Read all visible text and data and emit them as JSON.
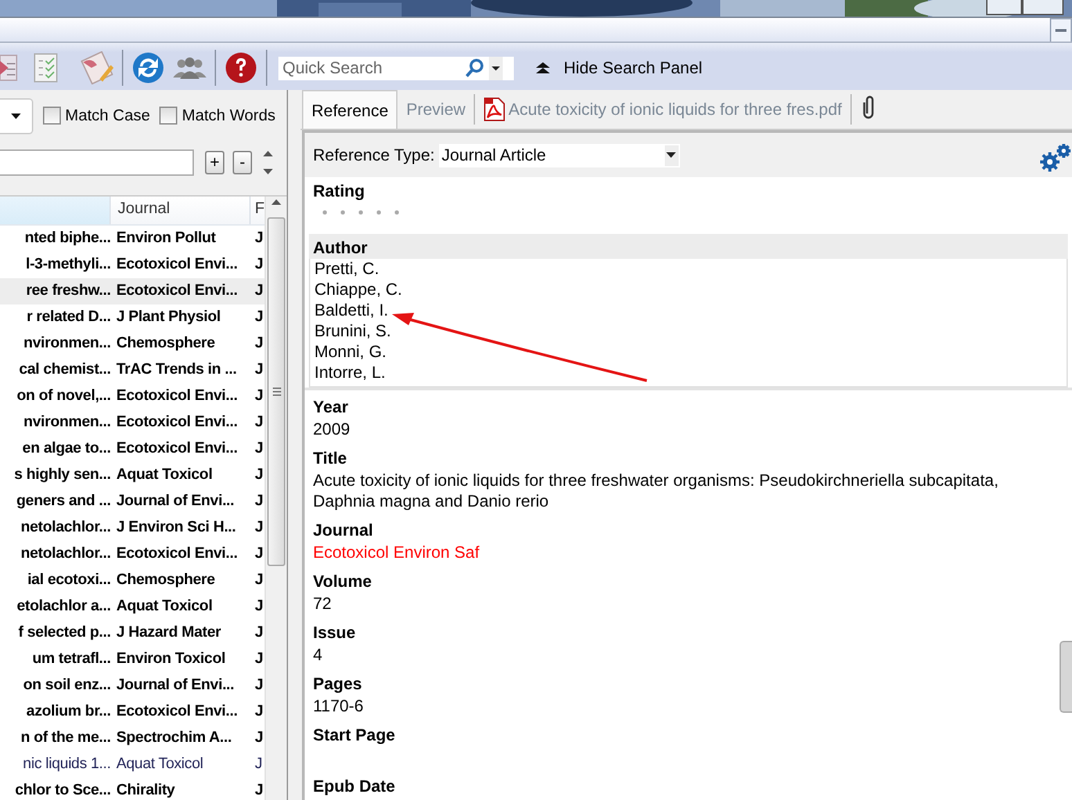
{
  "toolbar": {
    "search": {
      "placeholder": "Quick Search"
    },
    "hide_panel_button": "Hide Search Panel"
  },
  "search_options": {
    "checkboxes": [
      {
        "label": "Match Case",
        "checked": false
      },
      {
        "label": "Match Words",
        "checked": false
      }
    ],
    "add_button": "+",
    "remove_button": "-"
  },
  "reference_list": {
    "columns": [
      {
        "label": "Journal"
      },
      {
        "label": "F"
      }
    ],
    "rows": [
      {
        "title": "nted biphe...",
        "journal": "Environ Pollut",
        "column_3": "J",
        "unread": true,
        "selected": false
      },
      {
        "title": "l-3-methyli...",
        "journal": "Ecotoxicol Envi...",
        "column_3": "J",
        "unread": true,
        "selected": false
      },
      {
        "title": "ree freshw...",
        "journal": "Ecotoxicol Envi...",
        "column_3": "J",
        "unread": true,
        "selected": true
      },
      {
        "title": "r related D...",
        "journal": "J Plant Physiol",
        "column_3": "J",
        "unread": true,
        "selected": false
      },
      {
        "title": "nvironmen...",
        "journal": "Chemosphere",
        "column_3": "J",
        "unread": true,
        "selected": false
      },
      {
        "title": "cal chemist...",
        "journal": "TrAC Trends in ...",
        "column_3": "J",
        "unread": true,
        "selected": false
      },
      {
        "title": "on of novel,...",
        "journal": "Ecotoxicol Envi...",
        "column_3": "J",
        "unread": true,
        "selected": false
      },
      {
        "title": "nvironmen...",
        "journal": "Ecotoxicol Envi...",
        "column_3": "J",
        "unread": true,
        "selected": false
      },
      {
        "title": "en algae to...",
        "journal": "Ecotoxicol Envi...",
        "column_3": "J",
        "unread": true,
        "selected": false
      },
      {
        "title": "s highly sen...",
        "journal": "Aquat Toxicol",
        "column_3": "J",
        "unread": true,
        "selected": false
      },
      {
        "title": "geners and ...",
        "journal": "Journal of Envi...",
        "column_3": "J",
        "unread": true,
        "selected": false
      },
      {
        "title": "netolachlor...",
        "journal": "J Environ Sci H...",
        "column_3": "J",
        "unread": true,
        "selected": false
      },
      {
        "title": "netolachlor...",
        "journal": "Ecotoxicol Envi...",
        "column_3": "J",
        "unread": true,
        "selected": false
      },
      {
        "title": "ial ecotoxi...",
        "journal": "Chemosphere",
        "column_3": "J",
        "unread": true,
        "selected": false
      },
      {
        "title": "etolachlor a...",
        "journal": "Aquat Toxicol",
        "column_3": "J",
        "unread": true,
        "selected": false
      },
      {
        "title": "f selected p...",
        "journal": "J Hazard Mater",
        "column_3": "J",
        "unread": true,
        "selected": false
      },
      {
        "title": "um tetrafl...",
        "journal": "Environ Toxicol",
        "column_3": "J",
        "unread": true,
        "selected": false
      },
      {
        "title": "on soil enz...",
        "journal": "Journal of Envi...",
        "column_3": "J",
        "unread": true,
        "selected": false
      },
      {
        "title": "azolium br...",
        "journal": "Ecotoxicol Envi...",
        "column_3": "J",
        "unread": true,
        "selected": false
      },
      {
        "title": "n of the me...",
        "journal": "Spectrochim A...",
        "column_3": "J",
        "unread": true,
        "selected": false
      },
      {
        "title": "nic liquids 1...",
        "journal": "Aquat Toxicol",
        "column_3": "J",
        "unread": false,
        "selected": false
      },
      {
        "title": "chlor to Sce...",
        "journal": "Chirality",
        "column_3": "J",
        "unread": true,
        "selected": false
      }
    ]
  },
  "reference_panel": {
    "tabs": [
      {
        "label": "Reference",
        "kind": "text",
        "selected": true
      },
      {
        "label": "Preview",
        "kind": "text",
        "selected": false
      },
      {
        "label": "Acute toxicity of ionic liquids for three fres.pdf",
        "kind": "pdf",
        "selected": false
      }
    ],
    "reference_type": {
      "label": "Reference Type:",
      "value": "Journal Article"
    },
    "fields": [
      {
        "label": "Rating",
        "kind": "rating",
        "stars": 0,
        "focused": false
      },
      {
        "label": "Author",
        "kind": "list",
        "values": [
          "Pretti, C.",
          "Chiappe, C.",
          "Baldetti, I.",
          "Brunini, S.",
          "Monni, G.",
          "Intorre, L."
        ],
        "focused": true
      },
      {
        "label": "Year",
        "kind": "text",
        "value": "2009",
        "color": "#000000",
        "focused": false
      },
      {
        "label": "Title",
        "kind": "text",
        "value": "Acute toxicity of ionic liquids for three freshwater organisms: Pseudokirchneriella subcapitata, Daphnia magna and Danio rerio",
        "color": "#000000",
        "focused": false
      },
      {
        "label": "Journal",
        "kind": "text",
        "value": "Ecotoxicol Environ Saf",
        "color": "#ff0000",
        "focused": false
      },
      {
        "label": "Volume",
        "kind": "text",
        "value": "72",
        "color": "#000000",
        "focused": false
      },
      {
        "label": "Issue",
        "kind": "text",
        "value": "4",
        "color": "#000000",
        "focused": false
      },
      {
        "label": "Pages",
        "kind": "text",
        "value": "1170-6",
        "color": "#000000",
        "focused": false
      },
      {
        "label": "Start Page",
        "kind": "empty",
        "focused": false
      },
      {
        "label": "Epub Date",
        "kind": "empty",
        "focused": false
      }
    ],
    "annotation": {
      "kind": "arrow"
    }
  }
}
